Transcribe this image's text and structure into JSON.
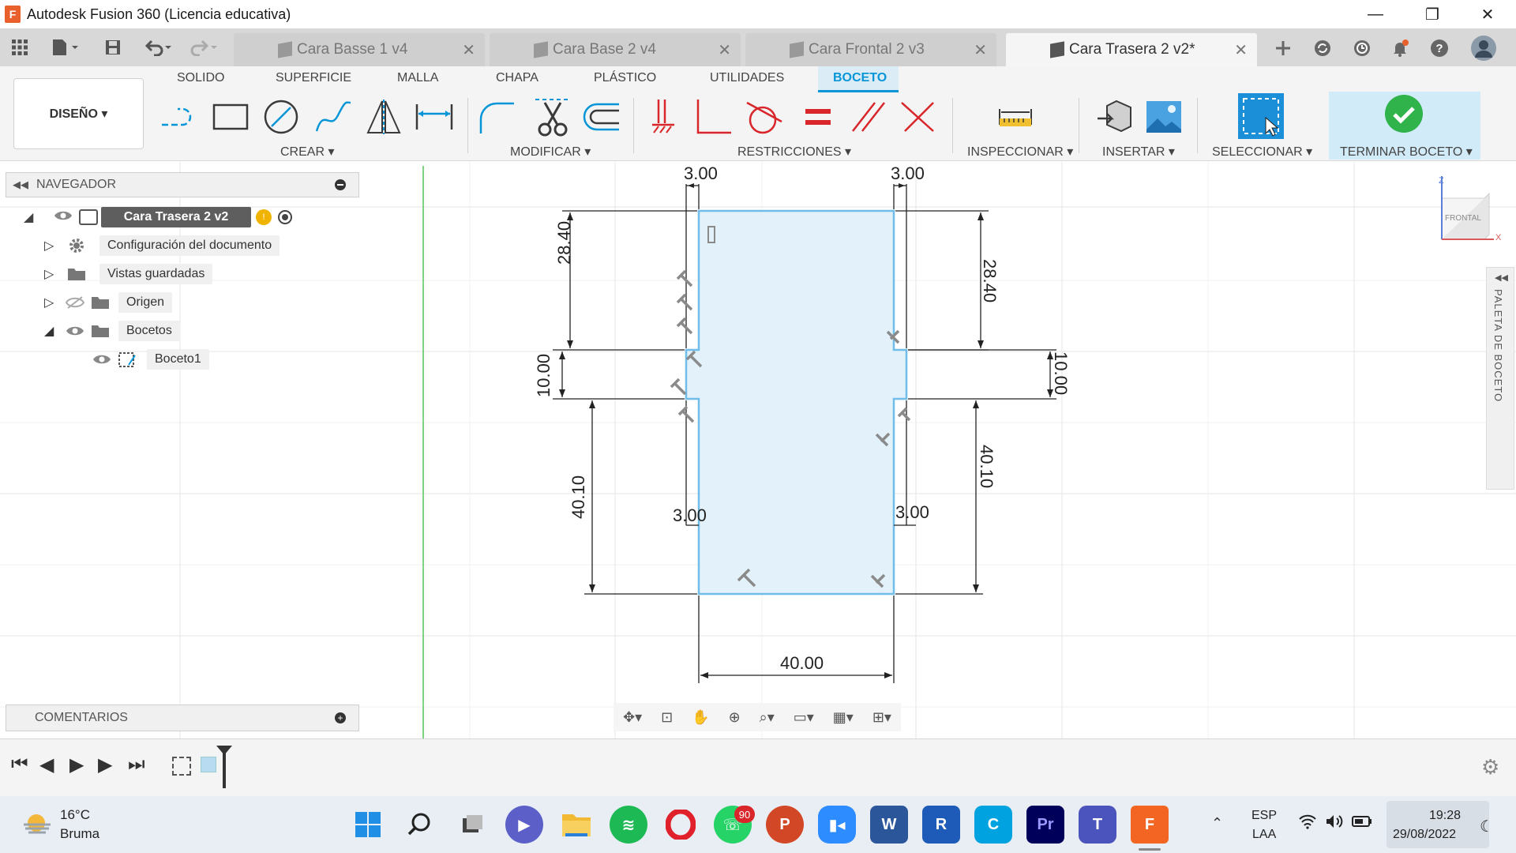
{
  "window": {
    "title": "Autodesk Fusion 360 (Licencia educativa)",
    "logo": "F",
    "minimize": "—",
    "maximize": "❐",
    "close": "✕"
  },
  "tabs": [
    {
      "label": "Cara Basse 1 v4",
      "active": false
    },
    {
      "label": "Cara Base 2 v4",
      "active": false
    },
    {
      "label": "Cara Frontal 2 v3",
      "active": false
    },
    {
      "label": "Cara Trasera 2 v2*",
      "active": true
    }
  ],
  "ribbon": {
    "tabs": [
      "SOLIDO",
      "SUPERFICIE",
      "MALLA",
      "CHAPA",
      "PLÁSTICO",
      "UTILIDADES",
      "BOCETO"
    ],
    "active_tab": "BOCETO",
    "workspace": "DISEÑO ▾",
    "groups": {
      "crear": "CREAR ▾",
      "modificar": "MODIFICAR ▾",
      "restricciones": "RESTRICCIONES ▾",
      "inspeccionar": "INSPECCIONAR ▾",
      "insertar": "INSERTAR ▾",
      "seleccionar": "SELECCIONAR ▾",
      "terminar": "TERMINAR BOCETO ▾"
    }
  },
  "navigator": {
    "title": "NAVEGADOR",
    "root": "Cara Trasera 2 v2",
    "items": [
      {
        "label": "Configuración del documento"
      },
      {
        "label": "Vistas guardadas"
      },
      {
        "label": "Origen"
      },
      {
        "label": "Bocetos"
      },
      {
        "label": "Boceto1"
      }
    ]
  },
  "comments": {
    "title": "COMENTARIOS"
  },
  "sketch": {
    "dimensions": {
      "top_left_width": "3.00",
      "top_right_width": "3.00",
      "left_upper_height": "28.40",
      "right_upper_height": "28.40",
      "left_mid_height": "10.00",
      "right_mid_height": "10.00",
      "left_lower_height": "40.10",
      "right_lower_height": "40.10",
      "bottom_left_width": "3.00",
      "bottom_right_width": "3.00",
      "total_width": "40.00"
    }
  },
  "viewcube": {
    "face": "FRONTAL",
    "axis_z": "Z",
    "axis_x": "X"
  },
  "palette": {
    "label": "PALETA DE BOCETO"
  },
  "taskbar": {
    "weather_temp": "16°C",
    "weather_desc": "Bruma",
    "whatsapp_badge": "90",
    "lang_line1": "ESP",
    "lang_line2": "LAA",
    "time": "19:28",
    "date": "29/08/2022"
  },
  "colors": {
    "accent": "#0696d7",
    "sketch_fill": "#e3f1fa",
    "sketch_line": "#6fbde8",
    "grid": "#e6e6e6",
    "origin_axis": "#7fd37f"
  }
}
